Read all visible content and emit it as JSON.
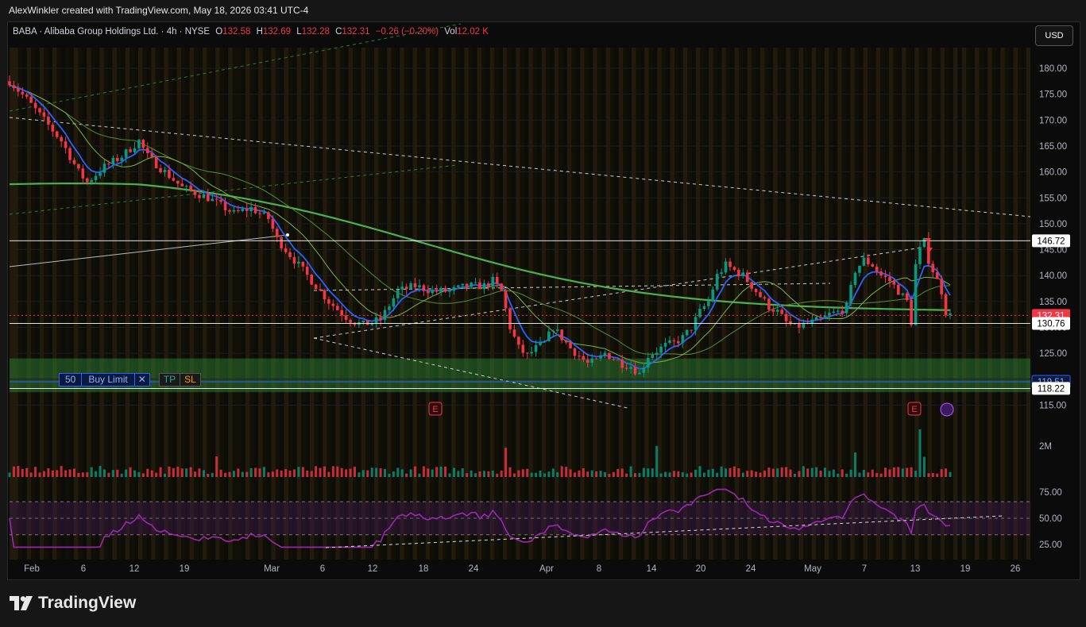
{
  "top_caption": "AlexWinkler created with TradingView.com, May 18, 2026 03:41 UTC-4",
  "brand": "TradingView",
  "currency_button": "USD",
  "header": {
    "symbol": "BABA · Alibaba Group Holdings Ltd. · 4h · NYSE",
    "o_label": "O",
    "o_value": "132.58",
    "h_label": "H",
    "h_value": "132.69",
    "l_label": "L",
    "l_value": "132.28",
    "c_label": "C",
    "c_value": "132.31",
    "change": "−0.26 (−0.20%)",
    "vol_label": "Vol",
    "vol_value": "12.02 K"
  },
  "order": {
    "qty": "50",
    "type": "Buy Limit",
    "close": "✕",
    "tp": "TP",
    "sl": "SL"
  },
  "colors": {
    "up": "#089981",
    "down": "#f23645",
    "ema_fast": "#2962ff",
    "ma_green": "#4caf50",
    "rsi": "#9c27b0",
    "zone": "#2e7d32"
  },
  "chart_data": {
    "type": "candlestick",
    "price_axis": {
      "ticks": [
        180,
        175,
        170,
        165,
        160,
        155,
        150,
        145,
        140,
        135,
        130,
        125,
        120,
        115
      ],
      "range": [
        114,
        183
      ]
    },
    "price_badges": [
      {
        "value": "146.72",
        "style": "white"
      },
      {
        "value": "132.31",
        "style": "red"
      },
      {
        "value": "130.76",
        "style": "white"
      },
      {
        "value": "119.51",
        "style": "blue"
      },
      {
        "value": "118.22",
        "style": "white"
      }
    ],
    "horizontal_levels": [
      146.72,
      130.76,
      119.51,
      118.22,
      132.31
    ],
    "demand_zone": [
      117.5,
      124.0
    ],
    "time_axis": [
      "Feb",
      "6",
      "12",
      "19",
      "Mar",
      "6",
      "12",
      "18",
      "24",
      "Apr",
      "8",
      "14",
      "20",
      "24",
      "May",
      "7",
      "13",
      "19",
      "26"
    ],
    "price_path": [
      [
        0,
        177.5
      ],
      [
        4,
        174
      ],
      [
        8,
        170
      ],
      [
        12,
        166
      ],
      [
        16,
        160
      ],
      [
        18,
        158
      ],
      [
        22,
        161
      ],
      [
        26,
        163
      ],
      [
        30,
        166
      ],
      [
        32,
        163
      ],
      [
        36,
        160
      ],
      [
        40,
        157
      ],
      [
        46,
        155
      ],
      [
        52,
        152
      ],
      [
        56,
        153
      ],
      [
        60,
        151
      ],
      [
        62,
        147
      ],
      [
        66,
        143
      ],
      [
        70,
        139
      ],
      [
        74,
        135
      ],
      [
        78,
        132
      ],
      [
        80,
        131
      ],
      [
        82,
        130.5
      ],
      [
        86,
        131.5
      ],
      [
        90,
        137
      ],
      [
        94,
        138
      ],
      [
        98,
        137
      ],
      [
        102,
        137
      ],
      [
        106,
        138
      ],
      [
        110,
        138
      ],
      [
        112,
        139
      ],
      [
        114,
        137
      ],
      [
        116,
        130
      ],
      [
        118,
        126
      ],
      [
        120,
        124.5
      ],
      [
        122,
        126
      ],
      [
        124,
        127
      ],
      [
        126,
        130
      ],
      [
        128,
        128
      ],
      [
        130,
        126
      ],
      [
        132,
        124.5
      ],
      [
        134,
        123
      ],
      [
        136,
        123.5
      ],
      [
        138,
        125
      ],
      [
        140,
        124
      ],
      [
        142,
        123
      ],
      [
        144,
        122.5
      ],
      [
        146,
        121
      ],
      [
        148,
        124.5
      ],
      [
        150,
        125.5
      ],
      [
        152,
        126.5
      ],
      [
        154,
        127
      ],
      [
        156,
        128
      ],
      [
        158,
        130
      ],
      [
        160,
        133
      ],
      [
        162,
        135
      ],
      [
        164,
        140
      ],
      [
        166,
        142
      ],
      [
        168,
        141
      ],
      [
        170,
        140
      ],
      [
        172,
        138
      ],
      [
        174,
        136
      ],
      [
        176,
        134
      ],
      [
        178,
        133
      ],
      [
        180,
        131
      ],
      [
        182,
        130
      ],
      [
        184,
        130.5
      ],
      [
        186,
        131
      ],
      [
        188,
        131.5
      ],
      [
        190,
        132.5
      ],
      [
        192,
        133
      ],
      [
        194,
        134
      ],
      [
        196,
        141
      ],
      [
        198,
        143
      ],
      [
        200,
        142
      ],
      [
        202,
        140
      ],
      [
        204,
        139
      ],
      [
        206,
        137
      ],
      [
        208,
        135
      ],
      [
        209,
        131
      ],
      [
        210,
        142
      ],
      [
        211,
        145
      ],
      [
        212,
        146.5
      ],
      [
        213,
        143
      ],
      [
        214,
        141
      ],
      [
        216,
        137
      ],
      [
        217,
        133
      ],
      [
        218,
        132.3
      ]
    ],
    "volume_axis": {
      "label": "2M"
    },
    "rsi_axis": {
      "ticks": [
        75,
        50,
        25
      ]
    },
    "earnings_markers": [
      "E",
      "E"
    ]
  }
}
